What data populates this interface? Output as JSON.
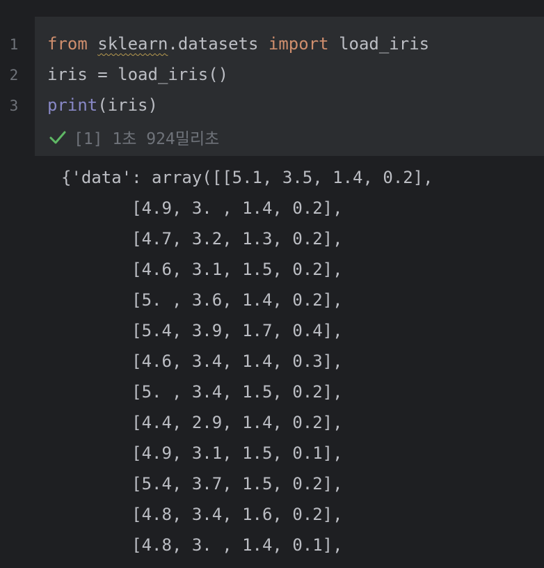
{
  "editor": {
    "line_numbers": [
      "1",
      "2",
      "3"
    ],
    "code": {
      "line1": {
        "kw_from": "from",
        "module": "sklearn",
        "rest_module": ".datasets",
        "kw_import": "import",
        "name": "load_iris"
      },
      "line2": {
        "text": "iris = load_iris()"
      },
      "line3": {
        "builtin": "print",
        "args": "(iris)"
      }
    },
    "status": {
      "icon": "check-icon",
      "text": "[1] 1초 924밀리초",
      "color": "#5fb865"
    }
  },
  "output": {
    "lines": [
      "{'data': array([[5.1, 3.5, 1.4, 0.2],",
      "       [4.9, 3. , 1.4, 0.2],",
      "       [4.7, 3.2, 1.3, 0.2],",
      "       [4.6, 3.1, 1.5, 0.2],",
      "       [5. , 3.6, 1.4, 0.2],",
      "       [5.4, 3.9, 1.7, 0.4],",
      "       [4.6, 3.4, 1.4, 0.3],",
      "       [5. , 3.4, 1.5, 0.2],",
      "       [4.4, 2.9, 1.4, 0.2],",
      "       [4.9, 3.1, 1.5, 0.1],",
      "       [5.4, 3.7, 1.5, 0.2],",
      "       [4.8, 3.4, 1.6, 0.2],",
      "       [4.8, 3. , 1.4, 0.1],"
    ]
  },
  "colors": {
    "background": "#1e1f22",
    "cell_background": "#2b2d30",
    "keyword": "#cf8e6d",
    "builtin": "#8888c6",
    "text": "#bcbec4",
    "muted": "#6f737a"
  }
}
